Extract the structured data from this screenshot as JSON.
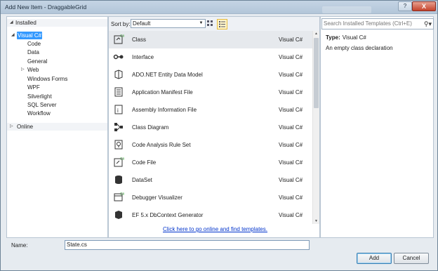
{
  "window": {
    "title": "Add New Item - DraggableGrid",
    "help_label": "?",
    "close_label": "X"
  },
  "tree": {
    "installed": "Installed",
    "visual_csharp": "Visual C#",
    "children": [
      "Code",
      "Data",
      "General",
      "Web",
      "Windows Forms",
      "WPF",
      "Silverlight",
      "SQL Server",
      "Workflow"
    ],
    "online": "Online"
  },
  "toolbar": {
    "sort_label": "Sort by:",
    "sort_value": "Default"
  },
  "items": [
    {
      "name": "Class",
      "lang": "Visual C#",
      "icon": "class-icon"
    },
    {
      "name": "Interface",
      "lang": "Visual C#",
      "icon": "interface-icon"
    },
    {
      "name": "ADO.NET Entity Data Model",
      "lang": "Visual C#",
      "icon": "entity-model-icon"
    },
    {
      "name": "Application Manifest File",
      "lang": "Visual C#",
      "icon": "manifest-icon"
    },
    {
      "name": "Assembly Information File",
      "lang": "Visual C#",
      "icon": "assembly-info-icon"
    },
    {
      "name": "Class Diagram",
      "lang": "Visual C#",
      "icon": "class-diagram-icon"
    },
    {
      "name": "Code Analysis Rule Set",
      "lang": "Visual C#",
      "icon": "rule-set-icon"
    },
    {
      "name": "Code File",
      "lang": "Visual C#",
      "icon": "code-file-icon"
    },
    {
      "name": "DataSet",
      "lang": "Visual C#",
      "icon": "dataset-icon"
    },
    {
      "name": "Debugger Visualizer",
      "lang": "Visual C#",
      "icon": "debugger-visualizer-icon"
    },
    {
      "name": "EF 5.x DbContext Generator",
      "lang": "Visual C#",
      "icon": "ef-generator-icon"
    }
  ],
  "online_link": "Click here to go online and find templates.",
  "search": {
    "placeholder": "Search Installed Templates (Ctrl+E)"
  },
  "details": {
    "type_label": "Type:",
    "type_value": "Visual C#",
    "description": "An empty class declaration"
  },
  "name_field": {
    "label": "Name:",
    "value": "State.cs"
  },
  "buttons": {
    "add": "Add",
    "cancel": "Cancel"
  }
}
